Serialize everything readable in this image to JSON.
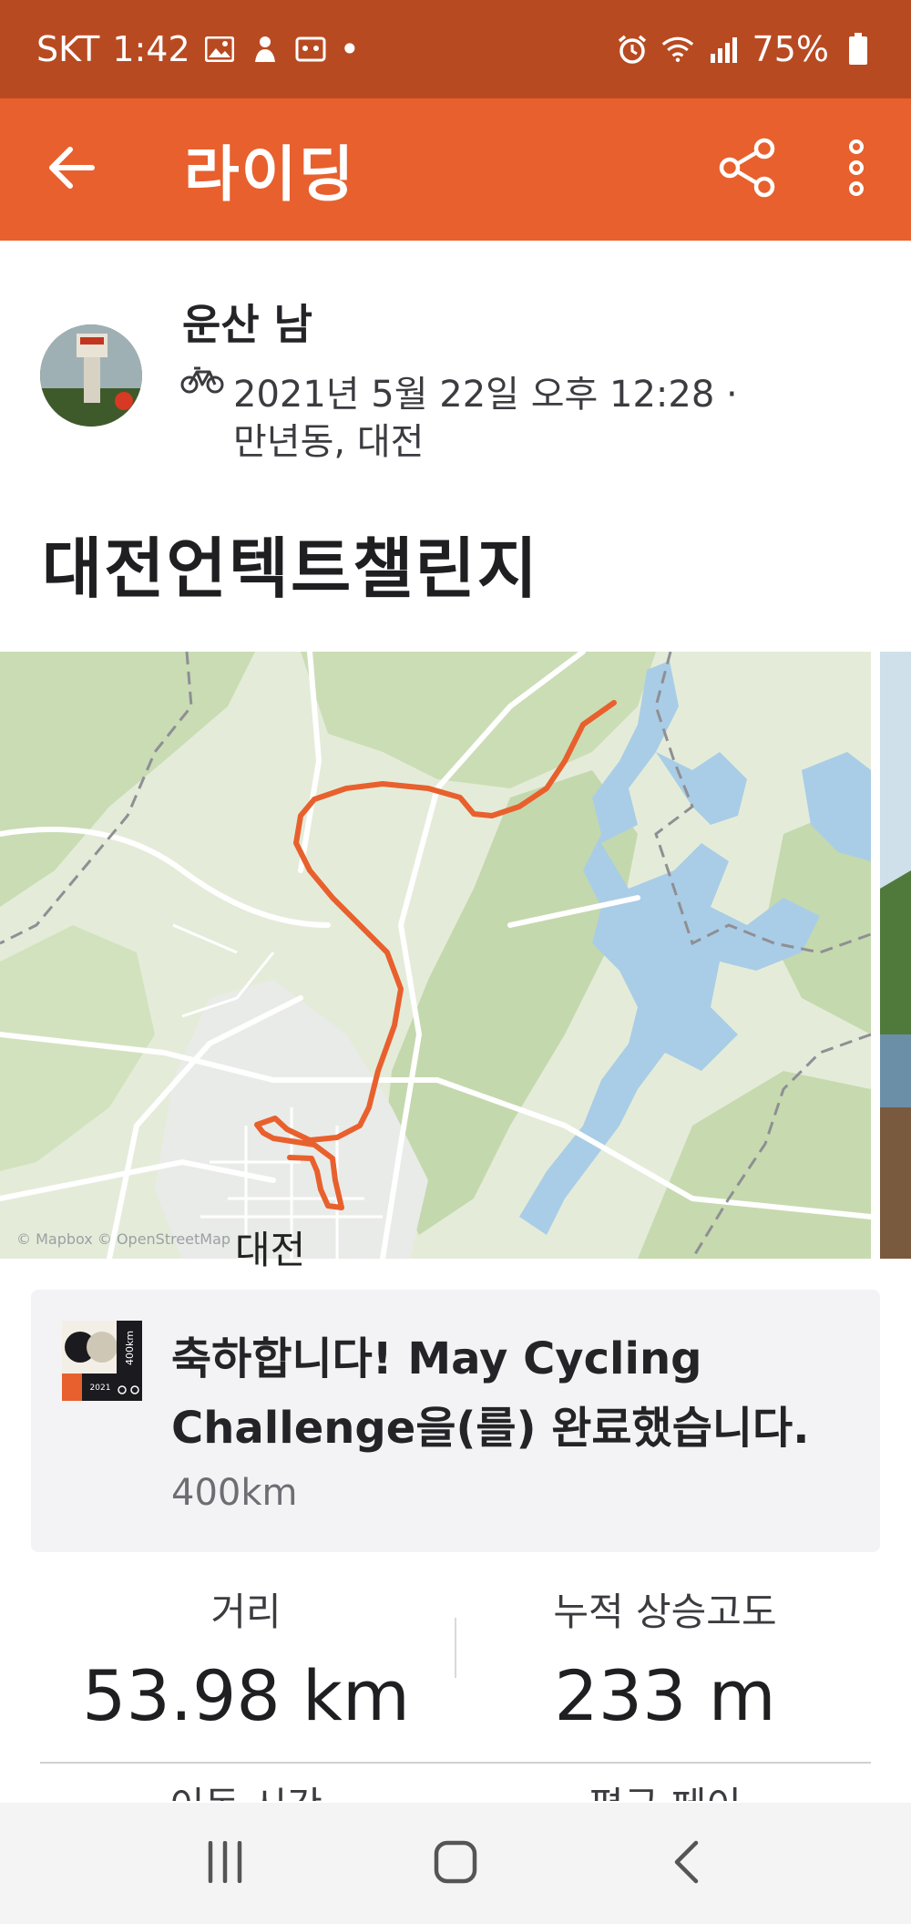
{
  "status_bar": {
    "carrier": "SKT",
    "time": "1:42",
    "dot": "•",
    "battery": "75%"
  },
  "app_bar": {
    "title": "라이딩",
    "icons": [
      "back-arrow-icon",
      "share-icon",
      "more-vert-icon"
    ]
  },
  "athlete": {
    "name": "운산 남",
    "activity_type_icon": "bike-icon",
    "datetime": "2021년 5월 22일 오후 12:28 ·",
    "location": "만년동, 대전"
  },
  "activity": {
    "title": "대전언텍트챌린지"
  },
  "map": {
    "attribution": "© Mapbox © OpenStreetMap",
    "city_label": "대전",
    "route_color": "#e8602d"
  },
  "challenge": {
    "message": "축하합니다! May Cycling Challenge을(를) 완료했습니다.",
    "distance": "400km",
    "badge_text": "400km",
    "badge_year": "2021"
  },
  "stats": {
    "distance_label": "거리",
    "distance_value": "53.98 km",
    "elevation_label": "누적 상승고도",
    "elevation_value": "233 m",
    "moving_time_label": "이동 시간",
    "avg_speed_label": "평균 페이"
  },
  "colors": {
    "status_bar": "#b84a22",
    "app_bar": "#e8602d",
    "accent": "#e8602d"
  },
  "nav_bar": {
    "icons": [
      "recents-icon",
      "home-icon",
      "back-icon"
    ]
  }
}
